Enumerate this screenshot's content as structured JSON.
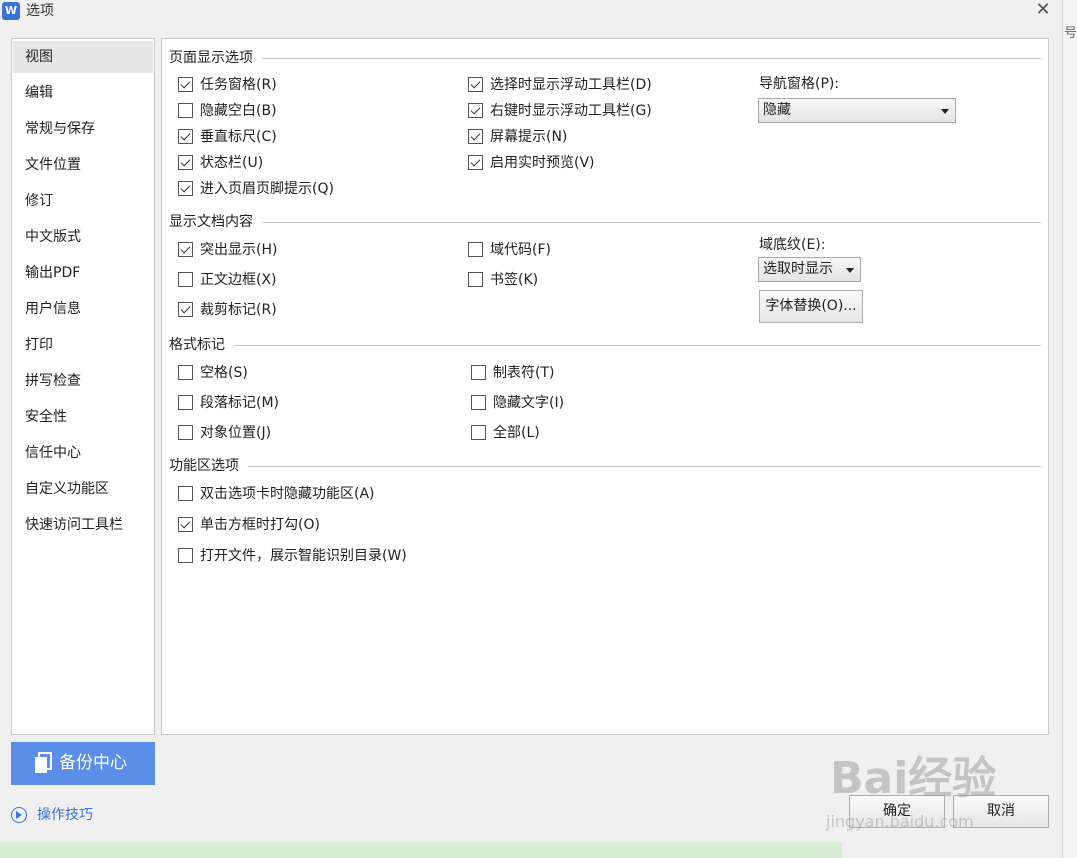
{
  "window": {
    "title": "选项",
    "app_icon": "W",
    "close_glyph": "✕",
    "side_edge_text": "号"
  },
  "sidebar": {
    "items": [
      {
        "label": "视图",
        "active": true
      },
      {
        "label": "编辑"
      },
      {
        "label": "常规与保存"
      },
      {
        "label": "文件位置"
      },
      {
        "label": "修订"
      },
      {
        "label": "中文版式"
      },
      {
        "label": "输出PDF"
      },
      {
        "label": "用户信息"
      },
      {
        "label": "打印"
      },
      {
        "label": "拼写检查"
      },
      {
        "label": "安全性"
      },
      {
        "label": "信任中心"
      },
      {
        "label": "自定义功能区"
      },
      {
        "label": "快速访问工具栏"
      }
    ],
    "backup_label": "备份中心",
    "tips_label": "操作技巧"
  },
  "sections": {
    "page_display": {
      "title": "页面显示选项",
      "options": [
        {
          "label": "任务窗格(R)",
          "checked": true
        },
        {
          "label": "隐藏空白(B)",
          "checked": false
        },
        {
          "label": "垂直标尺(C)",
          "checked": true
        },
        {
          "label": "状态栏(U)",
          "checked": true
        },
        {
          "label": "进入页眉页脚提示(Q)",
          "checked": true
        },
        {
          "label": "选择时显示浮动工具栏(D)",
          "checked": true
        },
        {
          "label": "右键时显示浮动工具栏(G)",
          "checked": true
        },
        {
          "label": "屏幕提示(N)",
          "checked": true
        },
        {
          "label": "启用实时预览(V)",
          "checked": true
        }
      ],
      "nav_pane_label": "导航窗格(P):",
      "nav_pane_value": "隐藏"
    },
    "doc_content": {
      "title": "显示文档内容",
      "options": [
        {
          "label": "突出显示(H)",
          "checked": true
        },
        {
          "label": "正文边框(X)",
          "checked": false
        },
        {
          "label": "裁剪标记(R)",
          "checked": true
        },
        {
          "label": "域代码(F)",
          "checked": false
        },
        {
          "label": "书签(K)",
          "checked": false
        }
      ],
      "field_shading_label": "域底纹(E):",
      "field_shading_value": "选取时显示",
      "font_sub_button": "字体替换(O)..."
    },
    "format_marks": {
      "title": "格式标记",
      "options": [
        {
          "label": "空格(S)",
          "checked": false
        },
        {
          "label": "段落标记(M)",
          "checked": false
        },
        {
          "label": "对象位置(J)",
          "checked": false
        },
        {
          "label": "制表符(T)",
          "checked": false
        },
        {
          "label": "隐藏文字(I)",
          "checked": false
        },
        {
          "label": "全部(L)",
          "checked": false
        }
      ]
    },
    "ribbon": {
      "title": "功能区选项",
      "options": [
        {
          "label": "双击选项卡时隐藏功能区(A)",
          "checked": false
        },
        {
          "label": "单击方框时打勾(O)",
          "checked": true
        },
        {
          "label": "打开文件，展示智能识别目录(W)",
          "checked": false
        }
      ]
    }
  },
  "footer": {
    "ok_label": "确定",
    "cancel_label": "取消"
  },
  "watermark": {
    "main": "Bai经验",
    "sub": "jingyan.baidu.com"
  }
}
